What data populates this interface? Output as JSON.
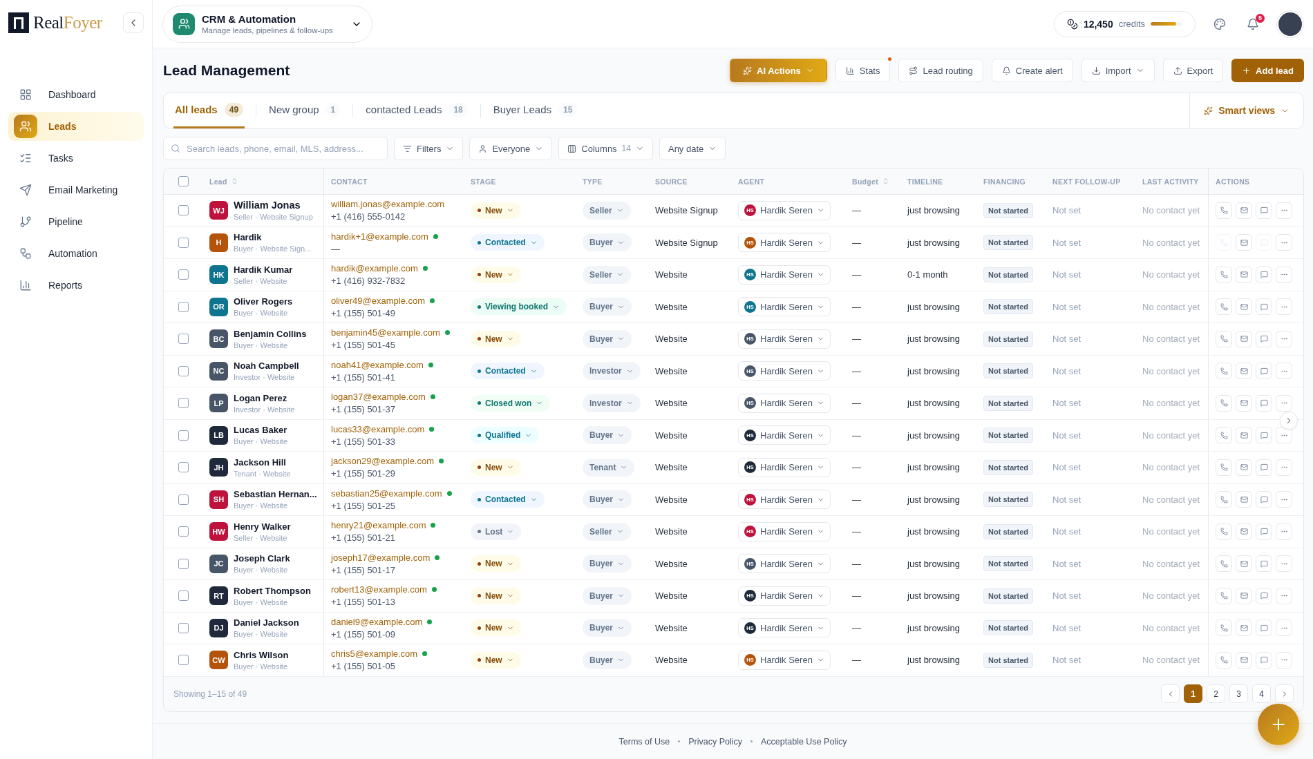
{
  "logo": {
    "part1": "Real",
    "part2": "Foyer"
  },
  "sidebar": {
    "items": [
      {
        "label": "Dashboard",
        "selected": false
      },
      {
        "label": "Leads",
        "selected": true
      },
      {
        "label": "Tasks",
        "selected": false
      },
      {
        "label": "Email Marketing",
        "selected": false
      },
      {
        "label": "Pipeline",
        "selected": false
      },
      {
        "label": "Automation",
        "selected": false
      },
      {
        "label": "Reports",
        "selected": false
      }
    ]
  },
  "module": {
    "title": "CRM & Automation",
    "subtitle": "Manage leads, pipelines & follow-ups"
  },
  "credits": {
    "amount": "12,450",
    "label": "credits",
    "level": 0.8
  },
  "notifications": {
    "count": "5"
  },
  "page_title": "Lead Management",
  "toolbar": [
    {
      "label": "AI Actions",
      "kind": "ai"
    },
    {
      "label": "Stats",
      "kind": "stats"
    },
    {
      "label": "Lead routing",
      "kind": "routing"
    },
    {
      "label": "Create alert",
      "kind": "alert"
    },
    {
      "label": "Import",
      "kind": "import"
    },
    {
      "label": "Export",
      "kind": "export"
    },
    {
      "label": "Add lead",
      "kind": "add"
    }
  ],
  "tabs": [
    {
      "label": "All leads",
      "count": "49",
      "selected": true
    },
    {
      "label": "New group",
      "count": "1",
      "selected": false
    },
    {
      "label": "contacted Leads",
      "count": "18",
      "selected": false
    },
    {
      "label": "Buyer Leads",
      "count": "15",
      "selected": false
    }
  ],
  "smart_views": "Smart views",
  "search": {
    "placeholder": "Search leads, phone, email, MLS, address..."
  },
  "filters": [
    {
      "label": "Filters",
      "kind": "filter"
    },
    {
      "label": "Everyone",
      "kind": "owner"
    },
    {
      "label": "Columns",
      "count": "14",
      "kind": "columns"
    },
    {
      "label": "Any date",
      "kind": "date"
    }
  ],
  "table": {
    "select_all_checked": false,
    "columns": [
      {
        "label": "Lead",
        "sortable": true
      },
      {
        "label": "CONTACT",
        "sortable": false
      },
      {
        "label": "STAGE",
        "sortable": false
      },
      {
        "label": "TYPE",
        "sortable": false
      },
      {
        "label": "SOURCE",
        "sortable": false
      },
      {
        "label": "AGENT",
        "sortable": false
      },
      {
        "label": "Budget",
        "sortable": true
      },
      {
        "label": "TIMELINE",
        "sortable": false
      },
      {
        "label": "FINANCING",
        "sortable": false
      },
      {
        "label": "NEXT FOLLOW-UP",
        "sortable": false
      },
      {
        "label": "LAST ACTIVITY",
        "sortable": false
      },
      {
        "label": "ACTIONS",
        "sortable": false
      }
    ],
    "rows": [
      {
        "checked": false,
        "initials": "WJ",
        "color": "#be123c",
        "name": "William Jonas",
        "subtitle": "Seller · Website Signup",
        "email": "william.jonas@example.com",
        "online": false,
        "phone": "+1 (416) 555-0142",
        "stage": {
          "label": "New",
          "kind": "new"
        },
        "type": "Seller",
        "source": "Website Signup",
        "agent": {
          "initials": "HS",
          "name": "Hardik Seren",
          "color": "#be123c"
        },
        "budget": "—",
        "timeline": "just browsing",
        "financing": "Not started",
        "follow_up": "Not set",
        "last_activity": "No contact yet",
        "limited": false
      },
      {
        "checked": false,
        "initials": "H",
        "color": "#b45309",
        "name": "Hardik",
        "subtitle": "Buyer · Website Sign...",
        "email": "hardik+1@example.com",
        "online": true,
        "phone": "—",
        "stage": {
          "label": "Contacted",
          "kind": "contacted"
        },
        "type": "Buyer",
        "source": "Website Signup",
        "agent": {
          "initials": "HS",
          "name": "Hardik Seren",
          "color": "#b45309"
        },
        "budget": "—",
        "timeline": "just browsing",
        "financing": "Not started",
        "follow_up": "Not set",
        "last_activity": "No contact yet",
        "limited": true
      },
      {
        "checked": false,
        "initials": "HK",
        "color": "#0e7490",
        "name": "Hardik Kumar",
        "subtitle": "Seller · Website",
        "email": "hardik@example.com",
        "online": true,
        "phone": "+1 (416) 932-7832",
        "stage": {
          "label": "New",
          "kind": "new"
        },
        "type": "Seller",
        "source": "Website",
        "agent": {
          "initials": "HS",
          "name": "Hardik Seren",
          "color": "#0e7490"
        },
        "budget": "—",
        "timeline": "0-1 month",
        "financing": "Not started",
        "follow_up": "Not set",
        "last_activity": "No contact yet",
        "limited": false
      },
      {
        "checked": false,
        "initials": "OR",
        "color": "#0e7490",
        "name": "Oliver Rogers",
        "subtitle": "Buyer · Website",
        "email": "oliver49@example.com",
        "online": true,
        "phone": "+1 (155) 501-49",
        "stage": {
          "label": "Viewing booked",
          "kind": "viewing"
        },
        "type": "Buyer",
        "source": "Website",
        "agent": {
          "initials": "HS",
          "name": "Hardik Seren",
          "color": "#0e7490"
        },
        "budget": "—",
        "timeline": "just browsing",
        "financing": "Not started",
        "follow_up": "Not set",
        "last_activity": "No contact yet",
        "limited": false
      },
      {
        "checked": false,
        "initials": "BC",
        "color": "#475569",
        "name": "Benjamin Collins",
        "subtitle": "Buyer · Website",
        "email": "benjamin45@example.com",
        "online": true,
        "phone": "+1 (155) 501-45",
        "stage": {
          "label": "New",
          "kind": "new"
        },
        "type": "Buyer",
        "source": "Website",
        "agent": {
          "initials": "HS",
          "name": "Hardik Seren",
          "color": "#475569"
        },
        "budget": "—",
        "timeline": "just browsing",
        "financing": "Not started",
        "follow_up": "Not set",
        "last_activity": "No contact yet",
        "limited": false
      },
      {
        "checked": false,
        "initials": "NC",
        "color": "#475569",
        "name": "Noah Campbell",
        "subtitle": "Investor · Website",
        "email": "noah41@example.com",
        "online": true,
        "phone": "+1 (155) 501-41",
        "stage": {
          "label": "Contacted",
          "kind": "contacted"
        },
        "type": "Investor",
        "source": "Website",
        "agent": {
          "initials": "HS",
          "name": "Hardik Seren",
          "color": "#475569"
        },
        "budget": "—",
        "timeline": "just browsing",
        "financing": "Not started",
        "follow_up": "Not set",
        "last_activity": "No contact yet",
        "limited": false
      },
      {
        "checked": false,
        "initials": "LP",
        "color": "#475569",
        "name": "Logan Perez",
        "subtitle": "Investor · Website",
        "email": "logan37@example.com",
        "online": true,
        "phone": "+1 (155) 501-37",
        "stage": {
          "label": "Closed won",
          "kind": "won"
        },
        "type": "Investor",
        "source": "Website",
        "agent": {
          "initials": "HS",
          "name": "Hardik Seren",
          "color": "#475569"
        },
        "budget": "—",
        "timeline": "just browsing",
        "financing": "Not started",
        "follow_up": "Not set",
        "last_activity": "No contact yet",
        "limited": false
      },
      {
        "checked": false,
        "initials": "LB",
        "color": "#1e293b",
        "name": "Lucas Baker",
        "subtitle": "Buyer · Website",
        "email": "lucas33@example.com",
        "online": true,
        "phone": "+1 (155) 501-33",
        "stage": {
          "label": "Qualified",
          "kind": "qualified"
        },
        "type": "Buyer",
        "source": "Website",
        "agent": {
          "initials": "HS",
          "name": "Hardik Seren",
          "color": "#1e293b"
        },
        "budget": "—",
        "timeline": "just browsing",
        "financing": "Not started",
        "follow_up": "Not set",
        "last_activity": "No contact yet",
        "limited": false
      },
      {
        "checked": false,
        "initials": "JH",
        "color": "#1e293b",
        "name": "Jackson Hill",
        "subtitle": "Tenant · Website",
        "email": "jackson29@example.com",
        "online": true,
        "phone": "+1 (155) 501-29",
        "stage": {
          "label": "New",
          "kind": "new"
        },
        "type": "Tenant",
        "source": "Website",
        "agent": {
          "initials": "HS",
          "name": "Hardik Seren",
          "color": "#1e293b"
        },
        "budget": "—",
        "timeline": "just browsing",
        "financing": "Not started",
        "follow_up": "Not set",
        "last_activity": "No contact yet",
        "limited": false
      },
      {
        "checked": false,
        "initials": "SH",
        "color": "#be123c",
        "name": "Sebastian Hernan...",
        "subtitle": "Buyer · Website",
        "email": "sebastian25@example.com",
        "online": true,
        "phone": "+1 (155) 501-25",
        "stage": {
          "label": "Contacted",
          "kind": "contacted"
        },
        "type": "Buyer",
        "source": "Website",
        "agent": {
          "initials": "HS",
          "name": "Hardik Seren",
          "color": "#be123c"
        },
        "budget": "—",
        "timeline": "just browsing",
        "financing": "Not started",
        "follow_up": "Not set",
        "last_activity": "No contact yet",
        "limited": false
      },
      {
        "checked": false,
        "initials": "HW",
        "color": "#be123c",
        "name": "Henry Walker",
        "subtitle": "Seller · Website",
        "email": "henry21@example.com",
        "online": true,
        "phone": "+1 (155) 501-21",
        "stage": {
          "label": "Lost",
          "kind": "lost"
        },
        "type": "Seller",
        "source": "Website",
        "agent": {
          "initials": "HS",
          "name": "Hardik Seren",
          "color": "#be123c"
        },
        "budget": "—",
        "timeline": "just browsing",
        "financing": "Not started",
        "follow_up": "Not set",
        "last_activity": "No contact yet",
        "limited": false
      },
      {
        "checked": false,
        "initials": "JC",
        "color": "#475569",
        "name": "Joseph Clark",
        "subtitle": "Buyer · Website",
        "email": "joseph17@example.com",
        "online": true,
        "phone": "+1 (155) 501-17",
        "stage": {
          "label": "New",
          "kind": "new"
        },
        "type": "Buyer",
        "source": "Website",
        "agent": {
          "initials": "HS",
          "name": "Hardik Seren",
          "color": "#475569"
        },
        "budget": "—",
        "timeline": "just browsing",
        "financing": "Not started",
        "follow_up": "Not set",
        "last_activity": "No contact yet",
        "limited": false
      },
      {
        "checked": false,
        "initials": "RT",
        "color": "#1e293b",
        "name": "Robert Thompson",
        "subtitle": "Buyer · Website",
        "email": "robert13@example.com",
        "online": true,
        "phone": "+1 (155) 501-13",
        "stage": {
          "label": "New",
          "kind": "new"
        },
        "type": "Buyer",
        "source": "Website",
        "agent": {
          "initials": "HS",
          "name": "Hardik Seren",
          "color": "#1e293b"
        },
        "budget": "—",
        "timeline": "just browsing",
        "financing": "Not started",
        "follow_up": "Not set",
        "last_activity": "No contact yet",
        "limited": false
      },
      {
        "checked": false,
        "initials": "DJ",
        "color": "#1e293b",
        "name": "Daniel Jackson",
        "subtitle": "Buyer · Website",
        "email": "daniel9@example.com",
        "online": true,
        "phone": "+1 (155) 501-09",
        "stage": {
          "label": "New",
          "kind": "new"
        },
        "type": "Buyer",
        "source": "Website",
        "agent": {
          "initials": "HS",
          "name": "Hardik Seren",
          "color": "#1e293b"
        },
        "budget": "—",
        "timeline": "just browsing",
        "financing": "Not started",
        "follow_up": "Not set",
        "last_activity": "No contact yet",
        "limited": false
      },
      {
        "checked": false,
        "initials": "CW",
        "color": "#b45309",
        "name": "Chris Wilson",
        "subtitle": "Buyer · Website",
        "email": "chris5@example.com",
        "online": true,
        "phone": "+1 (155) 501-05",
        "stage": {
          "label": "New",
          "kind": "new"
        },
        "type": "Buyer",
        "source": "Website",
        "agent": {
          "initials": "HS",
          "name": "Hardik Seren",
          "color": "#b45309"
        },
        "budget": "—",
        "timeline": "just browsing",
        "financing": "Not started",
        "follow_up": "Not set",
        "last_activity": "No contact yet",
        "limited": false
      }
    ]
  },
  "showing": "Showing 1–15 of 49",
  "pagination": [
    {
      "label": "1",
      "selected": true
    },
    {
      "label": "2",
      "selected": false
    },
    {
      "label": "3",
      "selected": false
    },
    {
      "label": "4",
      "selected": false
    }
  ],
  "footer_links": [
    "Terms of Use",
    "Privacy Policy",
    "Acceptable Use Policy"
  ]
}
